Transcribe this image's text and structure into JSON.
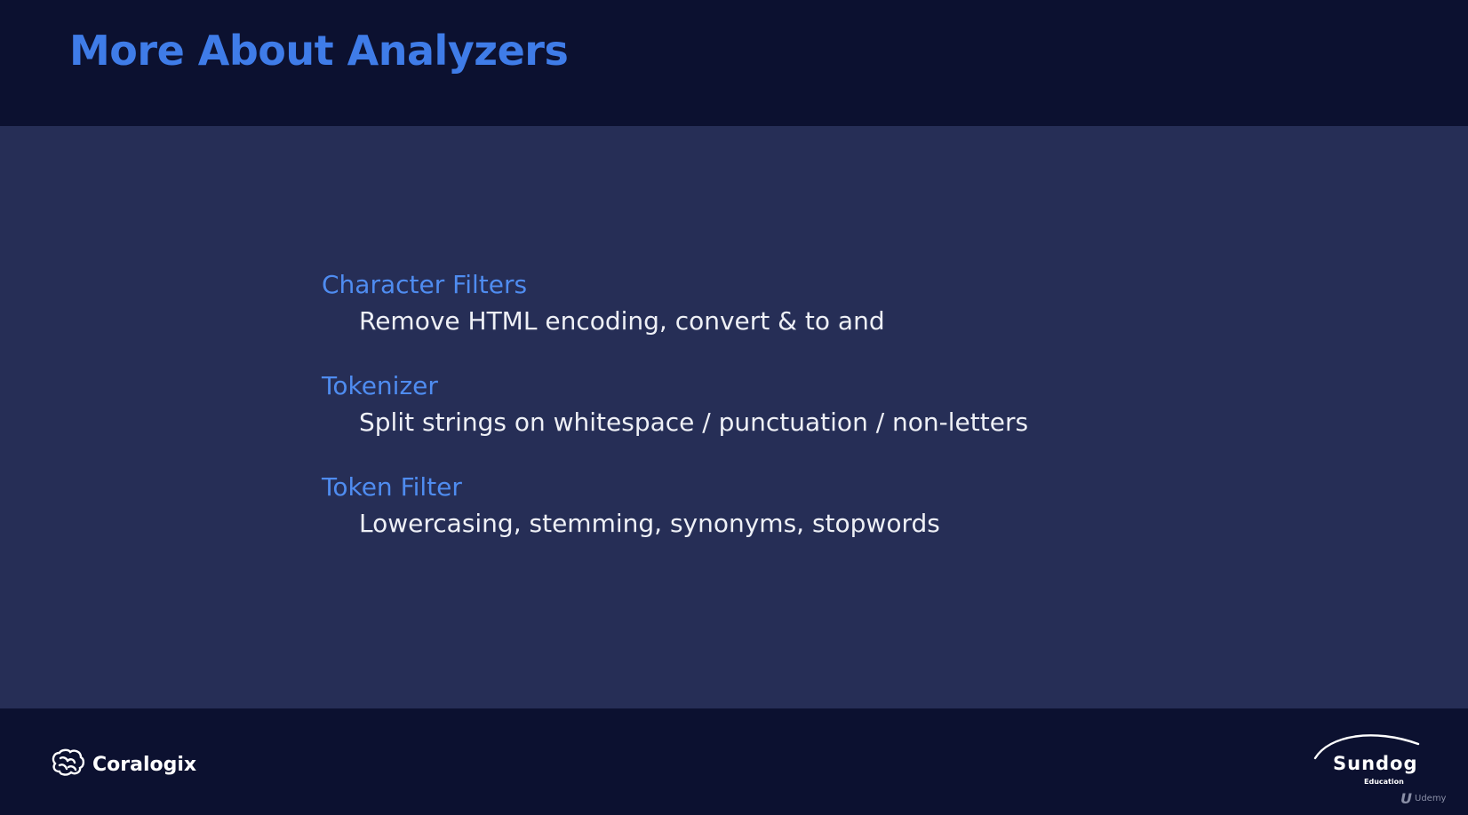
{
  "slide": {
    "title": "More About Analyzers"
  },
  "items": [
    {
      "heading": "Character Filters",
      "description": "Remove HTML encoding, convert & to and"
    },
    {
      "heading": "Tokenizer",
      "description": "Split strings on whitespace / punctuation / non-letters"
    },
    {
      "heading": "Token Filter",
      "description": "Lowercasing, stemming, synonyms, stopwords"
    }
  ],
  "footer": {
    "left_logo_text": "Coralogix",
    "left_logo_icon": "brain-icon",
    "right_logo_text": "Sundog",
    "right_logo_subtext": "Education",
    "watermark_text": "Udemy"
  },
  "colors": {
    "title": "#3f7ce8",
    "heading": "#4f8cf0",
    "body_text": "#eef0f6",
    "background_dark": "#0c1130",
    "background_content": "#262e56"
  }
}
